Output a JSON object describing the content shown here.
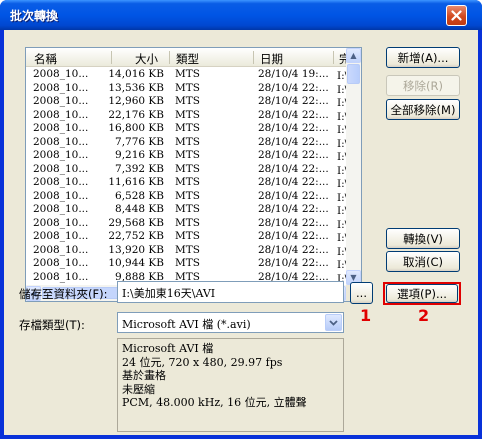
{
  "window": {
    "title": "批次轉換"
  },
  "list": {
    "columns": [
      "名稱",
      "大小",
      "類型",
      "日期",
      "完整"
    ],
    "rows": [
      {
        "name": "2008_10...",
        "size": "14,016 KB",
        "type": "MTS",
        "date": "28/10/4 19:...",
        "path": "I:\\美"
      },
      {
        "name": "2008_10...",
        "size": "13,536 KB",
        "type": "MTS",
        "date": "28/10/4 22:...",
        "path": "I:\\美"
      },
      {
        "name": "2008_10...",
        "size": "12,960 KB",
        "type": "MTS",
        "date": "28/10/4 22:...",
        "path": "I:\\美"
      },
      {
        "name": "2008_10...",
        "size": "22,176 KB",
        "type": "MTS",
        "date": "28/10/4 22:...",
        "path": "I:\\美"
      },
      {
        "name": "2008_10...",
        "size": "16,800 KB",
        "type": "MTS",
        "date": "28/10/4 22:...",
        "path": "I:\\美"
      },
      {
        "name": "2008_10...",
        "size": "7,776 KB",
        "type": "MTS",
        "date": "28/10/4 22:...",
        "path": "I:\\美"
      },
      {
        "name": "2008_10...",
        "size": "9,216 KB",
        "type": "MTS",
        "date": "28/10/4 22:...",
        "path": "I:\\美"
      },
      {
        "name": "2008_10...",
        "size": "7,392 KB",
        "type": "MTS",
        "date": "28/10/4 22:...",
        "path": "I:\\美"
      },
      {
        "name": "2008_10...",
        "size": "11,616 KB",
        "type": "MTS",
        "date": "28/10/4 22:...",
        "path": "I:\\美"
      },
      {
        "name": "2008_10...",
        "size": "6,528 KB",
        "type": "MTS",
        "date": "28/10/4 22:...",
        "path": "I:\\美"
      },
      {
        "name": "2008_10...",
        "size": "8,448 KB",
        "type": "MTS",
        "date": "28/10/4 22:...",
        "path": "I:\\美"
      },
      {
        "name": "2008_10...",
        "size": "29,568 KB",
        "type": "MTS",
        "date": "28/10/4 22:...",
        "path": "I:\\美"
      },
      {
        "name": "2008_10...",
        "size": "22,752 KB",
        "type": "MTS",
        "date": "28/10/4 22:...",
        "path": "I:\\美"
      },
      {
        "name": "2008_10...",
        "size": "13,920 KB",
        "type": "MTS",
        "date": "28/10/4 22:...",
        "path": "I:\\美"
      },
      {
        "name": "2008_10...",
        "size": "10,944 KB",
        "type": "MTS",
        "date": "28/10/4 22:...",
        "path": "I:\\美"
      },
      {
        "name": "2008_10...",
        "size": "9,888 KB",
        "type": "MTS",
        "date": "28/10/4 22:...",
        "path": "I:\\美"
      }
    ]
  },
  "buttons": {
    "add": "新增(A)...",
    "remove": "移除(R)",
    "remove_all": "全部移除(M)",
    "convert": "轉換(V)",
    "cancel": "取消(C)",
    "browse": "...",
    "options": "選項(P)..."
  },
  "save_folder": {
    "label": "儲存至資料夾(F):",
    "value": "I:\\美加東16天\\AVI"
  },
  "file_type": {
    "label": "存檔類型(T):",
    "value": "Microsoft AVI 檔 (*.avi)"
  },
  "info_lines": [
    "Microsoft AVI 檔",
    "24 位元, 720 x 480, 29.97 fps",
    "基於畫格",
    "未壓縮",
    "PCM, 48.000 kHz, 16 位元, 立體聲"
  ],
  "annotations": {
    "marker_1": "1",
    "marker_2": "2"
  },
  "colors": {
    "title_bar": "#0055e5",
    "close_button": "#d2491f",
    "annotation": "#e00000",
    "dialog_bg": "#ece9d8"
  },
  "icons": {
    "close": "close-icon",
    "dropdown": "chevron-down-icon"
  }
}
